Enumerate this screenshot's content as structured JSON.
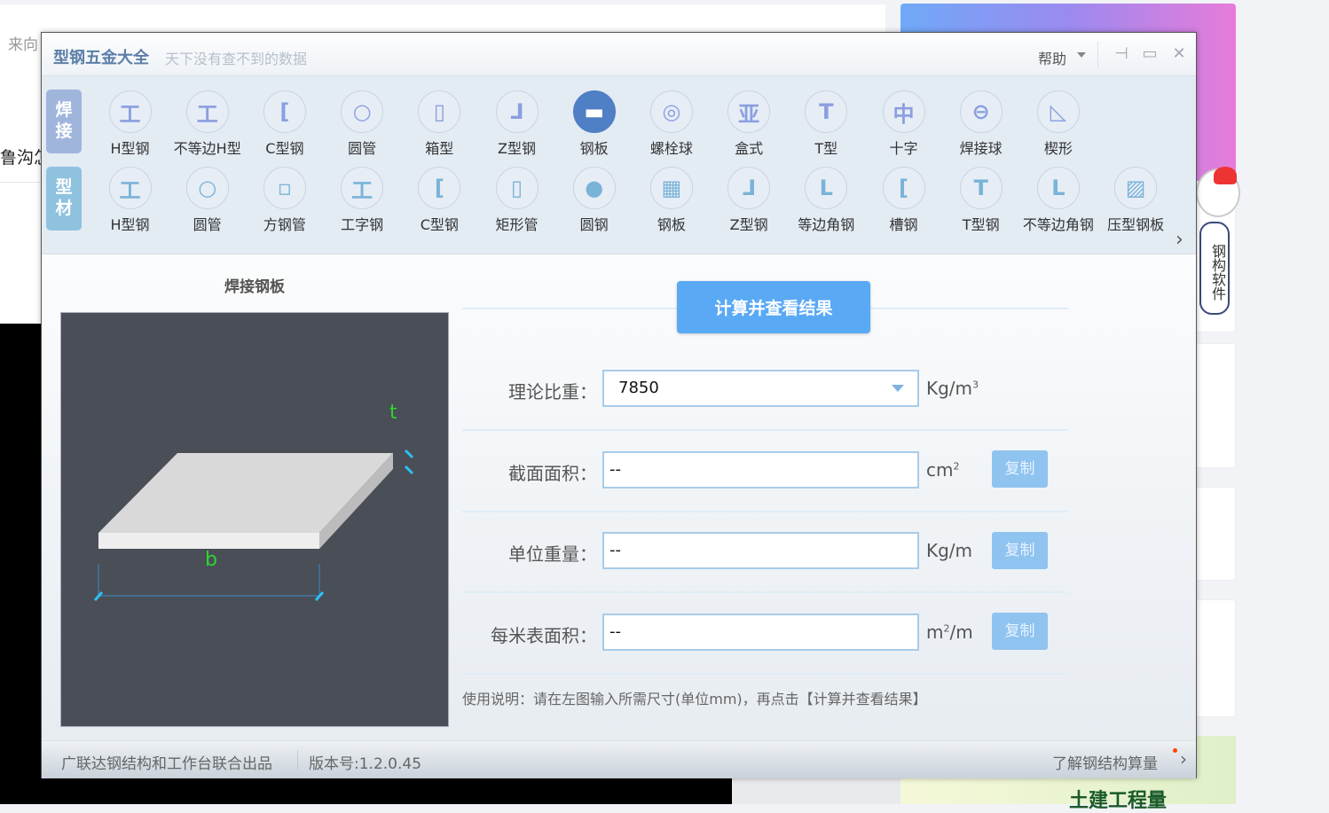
{
  "background": {
    "text_top_left": "来向",
    "text_left": "鲁沟怎",
    "mascot_text": "钢构软件",
    "ad_bottom_text": "土建工程量"
  },
  "window": {
    "app_name": "型钢五金大全",
    "slogan": "天下没有查不到的数据",
    "help": "帮助",
    "controls": {
      "pin": "⊣",
      "minimize": "▭",
      "close": "✕"
    }
  },
  "toolbar": {
    "tabs": [
      {
        "label": "焊接"
      },
      {
        "label": "型材"
      }
    ],
    "row_weld": [
      {
        "label": "H型钢",
        "glyph": "工"
      },
      {
        "label": "不等边H型",
        "glyph": "工"
      },
      {
        "label": "C型钢",
        "glyph": "["
      },
      {
        "label": "圆管",
        "glyph": "○"
      },
      {
        "label": "箱型",
        "glyph": "▯"
      },
      {
        "label": "Z型钢",
        "glyph": "⅃"
      },
      {
        "label": "钢板",
        "glyph": "▬"
      },
      {
        "label": "螺栓球",
        "glyph": "◎"
      },
      {
        "label": "盒式",
        "glyph": "亚"
      },
      {
        "label": "T型",
        "glyph": "T"
      },
      {
        "label": "十字",
        "glyph": "中"
      },
      {
        "label": "焊接球",
        "glyph": "⊖"
      },
      {
        "label": "楔形",
        "glyph": "◺"
      }
    ],
    "row_profile": [
      {
        "label": "H型钢",
        "glyph": "工"
      },
      {
        "label": "圆管",
        "glyph": "○"
      },
      {
        "label": "方钢管",
        "glyph": "▫"
      },
      {
        "label": "工字钢",
        "glyph": "工"
      },
      {
        "label": "C型钢",
        "glyph": "["
      },
      {
        "label": "矩形管",
        "glyph": "▯"
      },
      {
        "label": "圆钢",
        "glyph": "●"
      },
      {
        "label": "钢板",
        "glyph": "▦"
      },
      {
        "label": "Z型钢",
        "glyph": "⅃"
      },
      {
        "label": "等边角钢",
        "glyph": "L"
      },
      {
        "label": "槽钢",
        "glyph": "["
      },
      {
        "label": "T型钢",
        "glyph": "T"
      },
      {
        "label": "不等边角钢",
        "glyph": "L"
      },
      {
        "label": "压型钢板",
        "glyph": "▨"
      }
    ],
    "more": "›"
  },
  "main": {
    "diagram_title": "焊接钢板",
    "diagram_labels": {
      "t": "t",
      "b": "b"
    },
    "calc_button": "计算并查看结果",
    "density": {
      "label": "理论比重：",
      "value": "7850",
      "unit": "Kg/m",
      "sup": "3"
    },
    "area": {
      "label": "截面面积：",
      "value": "--",
      "unit": "cm",
      "sup": "2",
      "copy": "复制"
    },
    "weight": {
      "label": "单位重量：",
      "value": "--",
      "unit": "Kg/m",
      "copy": "复制"
    },
    "surface": {
      "label": "每米表面积：",
      "value": "--",
      "unit": "m",
      "sup": "2",
      "unit_tail": "/m",
      "copy": "复制"
    },
    "note": "使用说明：请在左图输入所需尺寸(单位mm)，再点击【计算并查看结果】"
  },
  "footer": {
    "credit": "广联达钢结构和工作台联合出品",
    "version": "版本号:1.2.0.45",
    "link": "了解钢结构算量",
    "arrow": "›"
  }
}
